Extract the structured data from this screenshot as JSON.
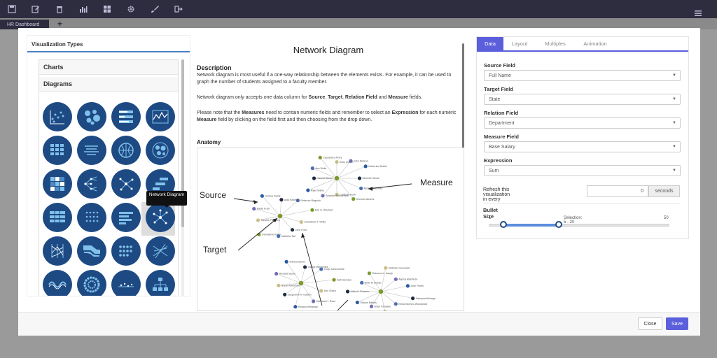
{
  "topbar": {
    "icons": [
      "save-icon",
      "edit-icon",
      "trash-icon",
      "bar-chart-icon",
      "grid-icon",
      "gear-icon",
      "brush-icon",
      "sign-out-icon",
      "menu-icon"
    ]
  },
  "tabbar": {
    "tab_label": "HR Dashboard",
    "add_label": "+"
  },
  "left": {
    "title": "Visualization Types",
    "categories": [
      "Charts",
      "Diagrams"
    ],
    "tooltip": "Network Diagram"
  },
  "middle": {
    "title": "Network Diagram",
    "description_heading": "Description",
    "paragraph1": "Network diagram is most useful if a one-way relationship between the elements exists. For example, it can be used to graph the number of students assigned to a faculty member.",
    "paragraph2_prefix": "Network diagram only accepts one data column for ",
    "p2_source": "Source",
    "p2_sep1": ", ",
    "p2_target": "Target",
    "p2_sep2": ", ",
    "p2_relation": "Relation Field",
    "p2_and": " and ",
    "p2_measure": "Measure",
    "p2_suffix": " fields.",
    "paragraph3_prefix": "Please note that the ",
    "p3_measures": "Measures",
    "p3_mid": " need to contain numeric fields and remember to select an ",
    "p3_expression": "Expression",
    "p3_mid2": " for each numeric ",
    "p3_measure": "Measure",
    "p3_suffix": " field by clicking on the field first and then choosing from the drop down.",
    "anatomy_heading": "Anatomy",
    "anatomy_labels": {
      "source": "Source",
      "target": "Target",
      "measure": "Measure"
    },
    "node_names": [
      "Michelle Steele",
      "Benny Melendez",
      "Keenan Abrams",
      "Cristhian Roth",
      "Susanne Richardson",
      "Ryan Marks",
      "Haneel Steele",
      "Ava Wells",
      "Cassandra Perry",
      "Kelly Queen",
      "John Mcleod",
      "Katherine Bethel",
      "John Ford",
      "Matthew Tait",
      "Genevieve Kwan",
      "Tamara Pacheco",
      "Nadia Kraft",
      "Joshua Fields",
      "Alda Kirkman",
      "Rebecca Regnolo",
      "Erik G. Rinehart",
      "Johnathan A. White",
      "Brian Tomasko",
      "Sharon Battles",
      "Alicia A. Ehrsson",
      "Brian M Studer",
      "Rebecca L. Haugh",
      "Michelle Greenwell",
      "Alyssa Aldelhuse",
      "Jose Flores",
      "Kateryna Akinaga",
      "Elena Morneo-Woodward",
      "Renad Talia",
      "Bryan Ackerman",
      "Richard Sacks",
      "Joshua Daniel",
      "Vitinge Menendez",
      "Cody Summerville",
      "Seth Bemran",
      "Ann Sharp",
      "Matthew H. Ross",
      "Ricardo Bergman",
      "Jacqueline A. Gaston"
    ]
  },
  "right": {
    "tabs": [
      "Data",
      "Layout",
      "Multiples",
      "Animation"
    ],
    "active_tab": "Data",
    "fields": [
      {
        "label": "Source Field",
        "value": "Full Name"
      },
      {
        "label": "Target Field",
        "value": "State"
      },
      {
        "label": "Relation Field",
        "value": "Department"
      },
      {
        "label": "Measure Field",
        "value": "Base Salary"
      },
      {
        "label": "Expression",
        "value": "Sum"
      }
    ],
    "refresh_label": "Refresh this visualization in every",
    "refresh_value": "0",
    "refresh_unit": "seconds",
    "bullet_label": "Bullet Size",
    "slider_min": "1",
    "slider_max": "50",
    "slider_selection": "Selection: 5 - 20",
    "slider_low": 5,
    "slider_high": 20
  },
  "footer": {
    "close_label": "Close",
    "save_label": "Save"
  },
  "colors": {
    "accent": "#5b5fdc",
    "icon_bg": "#1e4a84",
    "topbar": "#2e2c3f"
  }
}
